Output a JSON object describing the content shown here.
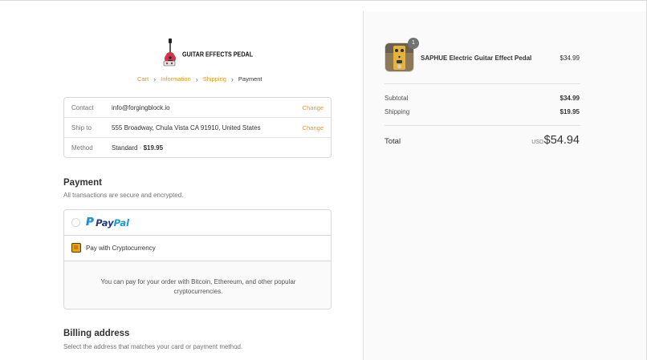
{
  "store": {
    "logo_text": "GUITAR EFFECTS PEDAL"
  },
  "breadcrumb": {
    "items": [
      "Cart",
      "Information",
      "Shipping",
      "Payment"
    ]
  },
  "review": {
    "contact": {
      "label": "Contact",
      "value": "info@forgingblock.io",
      "action": "Change"
    },
    "ship_to": {
      "label": "Ship to",
      "value": "555 Broadway, Chula Vista CA 91910, United States",
      "action": "Change"
    },
    "method": {
      "label": "Method",
      "value": "Standard · ",
      "price": "$19.95"
    }
  },
  "payment": {
    "title": "Payment",
    "subtitle": "All transactions are secure and encrypted.",
    "options": {
      "paypal": {
        "logo_pay": "Pay",
        "logo_pal": "Pal",
        "selected": false
      },
      "crypto": {
        "label": "Pay with Cryptocurrency",
        "selected": true
      }
    },
    "crypto_description": "You can pay for your order with Bitcoin, Ethereum, and other popular cryptocurrencies."
  },
  "billing": {
    "title": "Billing address",
    "subtitle": "Select the address that matches your card or payment method."
  },
  "summary": {
    "product": {
      "name": "SAPHUE Electric Guitar Effect Pedal",
      "price": "$34.99",
      "quantity": "1"
    },
    "subtotal": {
      "label": "Subtotal",
      "value": "$34.99"
    },
    "shipping": {
      "label": "Shipping",
      "value": "$19.95"
    },
    "total": {
      "label": "Total",
      "currency": "USD",
      "value": "$54.94"
    }
  },
  "colors": {
    "accent": "#e8951b",
    "sidebar_bg": "#fafafa",
    "border": "#d9d9d9",
    "paypal_dark": "#253b80",
    "paypal_light": "#179bd7"
  },
  "icons": {
    "logo": "guitar-icon",
    "breadcrumb_separator": "chevron-right-icon",
    "product_thumbnail": "pedal-icon"
  }
}
